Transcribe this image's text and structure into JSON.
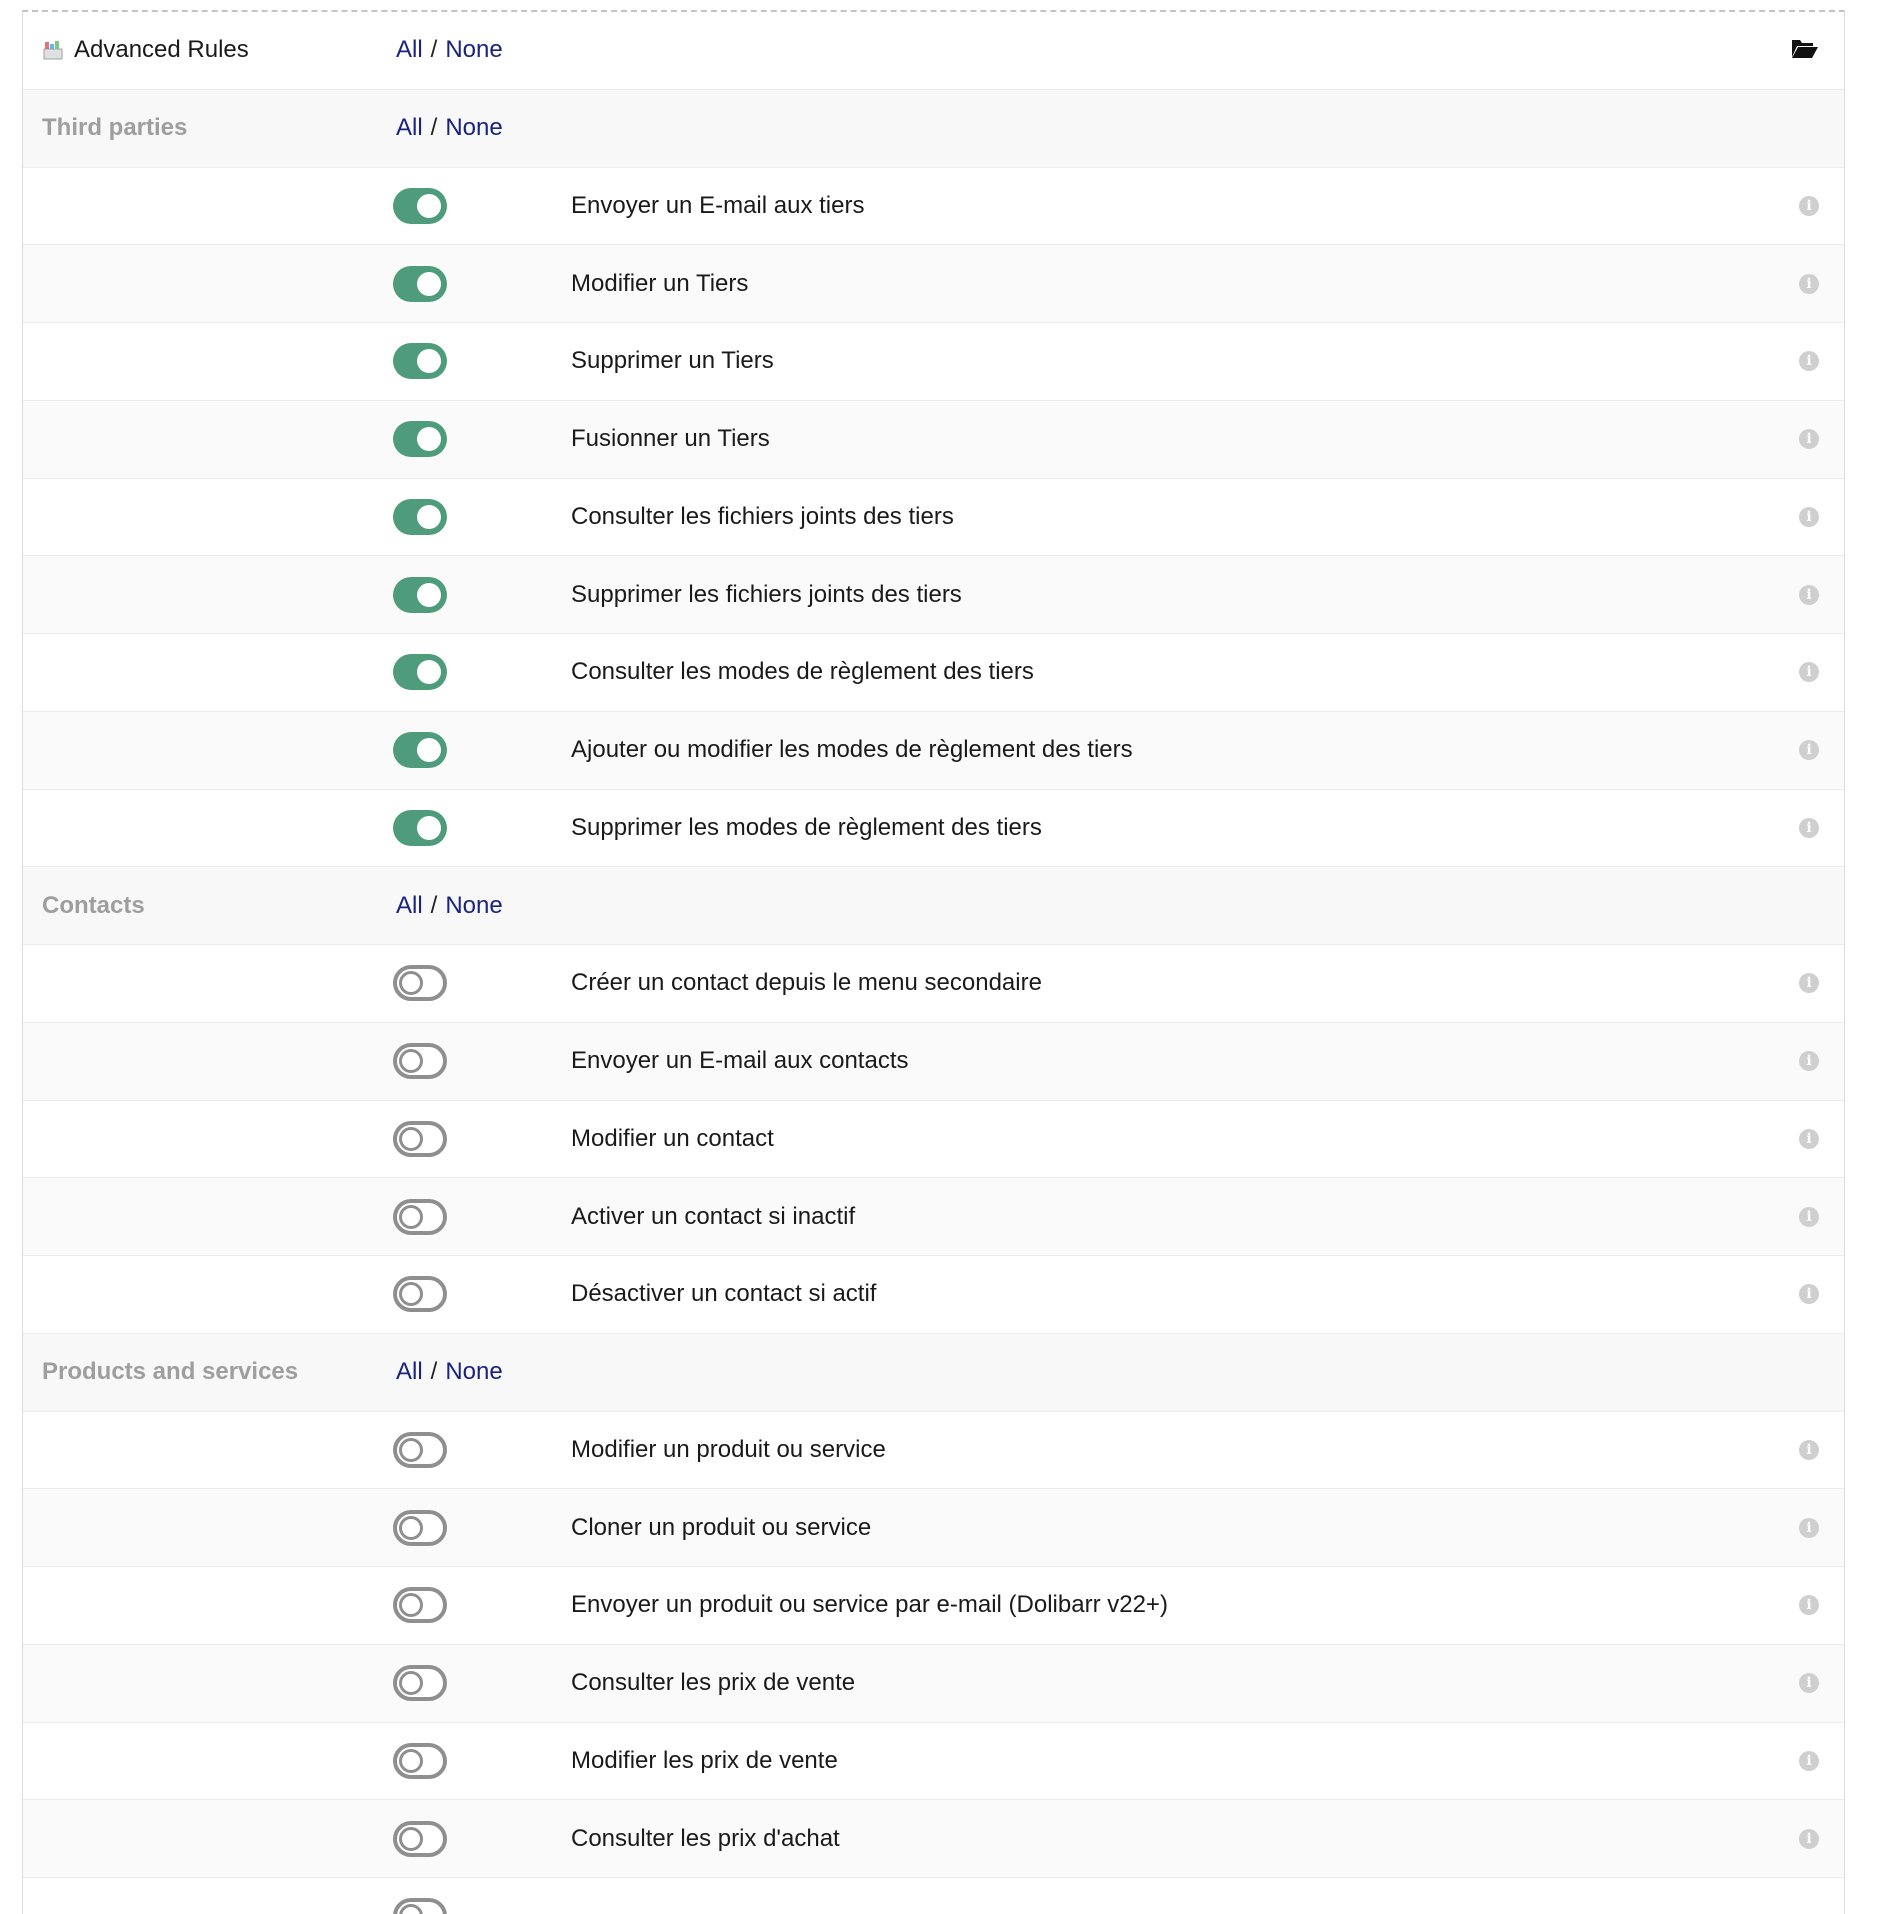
{
  "header": {
    "title": "Advanced Rules",
    "all_label": "All",
    "separator": "/",
    "none_label": "None",
    "module_icon": "module-icon",
    "folder_icon": "folder-open-icon"
  },
  "groups": [
    {
      "title": "Third parties",
      "all_label": "All",
      "none_label": "None",
      "rules": [
        {
          "label": "Envoyer un E-mail aux tiers",
          "enabled": true
        },
        {
          "label": "Modifier un Tiers",
          "enabled": true
        },
        {
          "label": "Supprimer un Tiers",
          "enabled": true
        },
        {
          "label": "Fusionner un Tiers",
          "enabled": true
        },
        {
          "label": "Consulter les fichiers joints des tiers",
          "enabled": true
        },
        {
          "label": "Supprimer les fichiers joints des tiers",
          "enabled": true
        },
        {
          "label": "Consulter les modes de règlement des tiers",
          "enabled": true
        },
        {
          "label": "Ajouter ou modifier les modes de règlement des tiers",
          "enabled": true
        },
        {
          "label": "Supprimer les modes de règlement des tiers",
          "enabled": true
        }
      ]
    },
    {
      "title": "Contacts",
      "all_label": "All",
      "none_label": "None",
      "rules": [
        {
          "label": "Créer un contact depuis le menu secondaire",
          "enabled": false
        },
        {
          "label": "Envoyer un E-mail aux contacts",
          "enabled": false
        },
        {
          "label": "Modifier un contact",
          "enabled": false
        },
        {
          "label": "Activer un contact si inactif",
          "enabled": false
        },
        {
          "label": "Désactiver un contact si actif",
          "enabled": false
        }
      ]
    },
    {
      "title": "Products and services",
      "all_label": "All",
      "none_label": "None",
      "rules": [
        {
          "label": "Modifier un produit ou service",
          "enabled": false
        },
        {
          "label": "Cloner un produit ou service",
          "enabled": false
        },
        {
          "label": "Envoyer un produit ou service par e-mail (Dolibarr v22+)",
          "enabled": false
        },
        {
          "label": "Consulter les prix de vente",
          "enabled": false
        },
        {
          "label": "Modifier les prix de vente",
          "enabled": false
        },
        {
          "label": "Consulter les prix d'achat",
          "enabled": false
        },
        {
          "label": "",
          "enabled": false
        }
      ]
    }
  ],
  "colors": {
    "toggle_on": "#4e9c7b",
    "toggle_off_border": "#8f8f8f",
    "link": "#1a237e",
    "group_title": "#9e9e9e"
  }
}
